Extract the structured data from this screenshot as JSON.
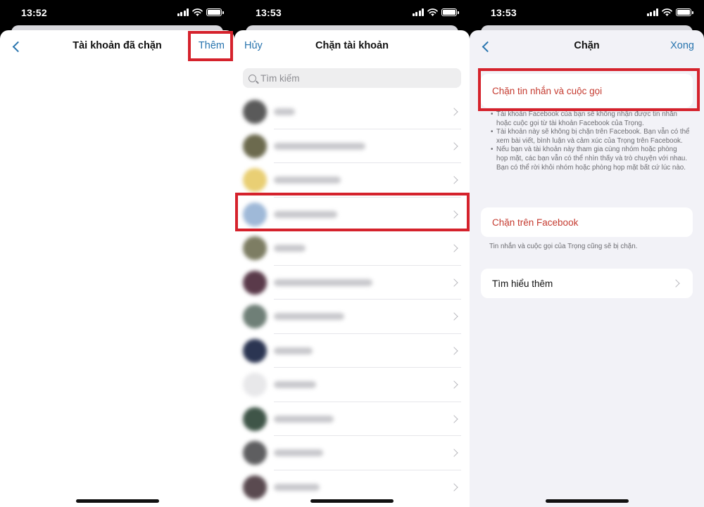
{
  "panels": [
    {
      "time": "13:52",
      "title": "Tài khoản đã chặn",
      "right_button": "Thêm"
    },
    {
      "time": "13:53",
      "title": "Chặn tài khoản",
      "left_button": "Hủy",
      "search_placeholder": "Tìm kiếm"
    },
    {
      "time": "13:53",
      "title": "Chặn",
      "right_button": "Xong",
      "block_messages_label": "Chặn tin nhắn và cuộc gọi",
      "block_messages_notes": [
        "Tài khoản Facebook của bạn sẽ không nhận được tin nhắn hoặc cuộc gọi từ tài khoản Facebook của Trọng.",
        "Tài khoản này sẽ không bị chặn trên Facebook. Bạn vẫn có thể xem bài viết, bình luận và cảm xúc của Trọng trên Facebook.",
        "Nếu bạn và tài khoản này tham gia cùng nhóm hoặc phòng họp mặt, các bạn vẫn có thể nhìn thấy và trò chuyện với nhau. Bạn có thể rời khỏi nhóm hoặc phòng họp mặt bất cứ lúc nào."
      ],
      "block_facebook_label": "Chặn trên Facebook",
      "block_facebook_caption": "Tin nhắn và cuộc gọi của Trọng cũng sẽ bị chặn.",
      "learn_more_label": "Tìm hiểu thêm"
    }
  ],
  "colors": {
    "accent": "#2874ae",
    "destructive": "#c53b30",
    "highlight_box": "#d5222c"
  },
  "icons": {
    "back": "chevron-left-icon",
    "row_chevron": "chevron-right-icon",
    "search": "search-icon"
  }
}
